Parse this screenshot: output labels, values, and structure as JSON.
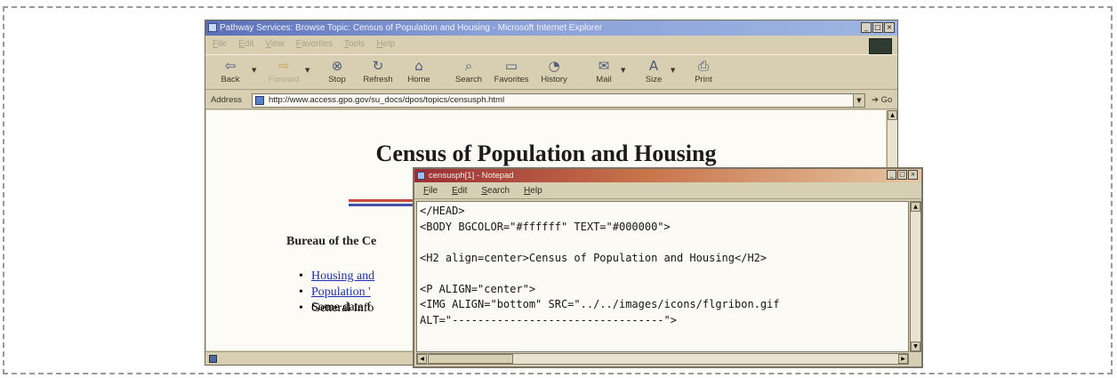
{
  "browser": {
    "title": "Pathway Services: Browse Topic: Census of Population and Housing - Microsoft Internet Explorer",
    "window_buttons": [
      "_",
      "□",
      "×"
    ],
    "menu": [
      "File",
      "Edit",
      "View",
      "Favorites",
      "Tools",
      "Help"
    ],
    "toolbar": [
      {
        "label": "Back",
        "icon": "back-arrow-icon",
        "glyph": "⇦"
      },
      {
        "label": "Forward",
        "icon": "forward-arrow-icon",
        "glyph": "⇨",
        "disabled": true
      },
      {
        "label": "Stop",
        "icon": "stop-icon",
        "glyph": "⊗"
      },
      {
        "label": "Refresh",
        "icon": "refresh-icon",
        "glyph": "↻"
      },
      {
        "label": "Home",
        "icon": "home-icon",
        "glyph": "⌂"
      },
      {
        "label": "Search",
        "icon": "search-icon",
        "glyph": "⌕"
      },
      {
        "label": "Favorites",
        "icon": "favorites-icon",
        "glyph": "▭"
      },
      {
        "label": "History",
        "icon": "history-icon",
        "glyph": "◔"
      },
      {
        "label": "Mail",
        "icon": "mail-icon",
        "glyph": "✉"
      },
      {
        "label": "Size",
        "icon": "font-size-icon",
        "glyph": "A"
      },
      {
        "label": "Print",
        "icon": "print-icon",
        "glyph": "⎙"
      }
    ],
    "address_label": "Address",
    "url": "http://www.access.gpo.gov/su_docs/dpos/topics/censusph.html",
    "go_label": "Go"
  },
  "page": {
    "heading": "Census of Population and Housing",
    "bureau": "Bureau of the Ce",
    "list": [
      {
        "text": "Housing and",
        "link": true
      },
      {
        "text": "Population '",
        "link": true
      },
      {
        "text": "General info",
        "link": false,
        "continuation": "Some data f"
      }
    ]
  },
  "notepad": {
    "title": "censusph[1] - Notepad",
    "window_buttons": [
      "_",
      "□",
      "×"
    ],
    "menu": [
      "File",
      "Edit",
      "Search",
      "Help"
    ],
    "lines": [
      "</HEAD>",
      "<BODY BGCOLOR=\"#ffffff\" TEXT=\"#000000\">",
      "",
      "<H2 align=center>Census of Population and Housing</H2>",
      "",
      "<P ALIGN=\"center\">",
      "<IMG ALIGN=\"bottom\" SRC=\"../../images/icons/flgribon.gif",
      "ALT=\"---------------------------------\">"
    ]
  }
}
